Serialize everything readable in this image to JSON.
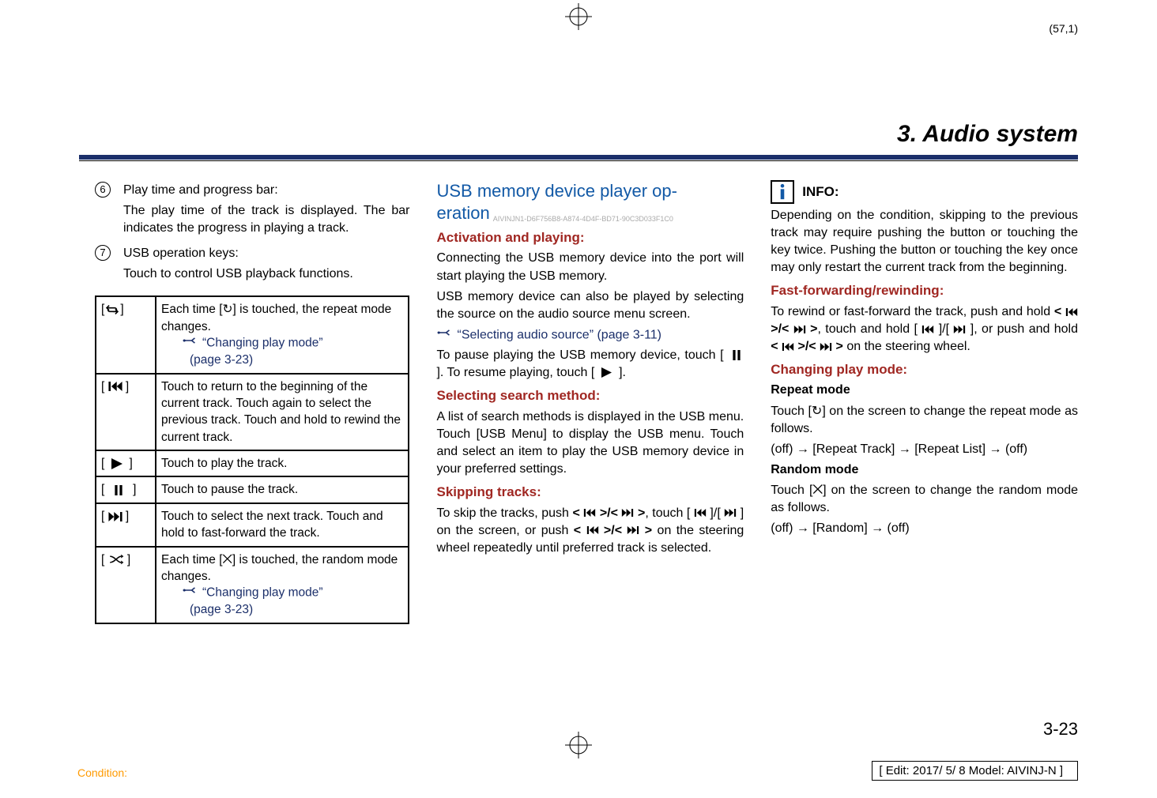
{
  "page_note_top": "(57,1)",
  "chapter_title": "3. Audio system",
  "col1": {
    "items": [
      {
        "num": "⑥",
        "title": "Play time and progress bar:",
        "desc": "The play time of the track is displayed. The bar indicates the progress in playing a track."
      },
      {
        "num": "⑦",
        "title": "USB operation keys:",
        "desc": "Touch to control USB playback functions."
      }
    ],
    "table": [
      {
        "icon": "repeat",
        "lines": [
          "Each time [↻] is touched, the repeat mode changes."
        ],
        "xref_label": "“Changing play mode”",
        "xref_page": "(page 3-23)"
      },
      {
        "icon": "prev",
        "lines": [
          "Touch to return to the beginning of the current track. Touch again to select the previous track. Touch and hold to rewind the current track."
        ]
      },
      {
        "icon": "play",
        "lines": [
          "Touch to play the track."
        ]
      },
      {
        "icon": "pause",
        "lines": [
          "Touch to pause the track."
        ]
      },
      {
        "icon": "next",
        "lines": [
          "Touch to select the next track. Touch and hold to fast-forward the track."
        ]
      },
      {
        "icon": "shuffle",
        "lines": [
          "Each time [⨉] is touched, the random mode changes."
        ],
        "xref_label": "“Changing play mode”",
        "xref_page": "(page 3-23)"
      }
    ]
  },
  "col2": {
    "sec_title1": "USB memory device player op-",
    "sec_title2": "eration",
    "sec_id": "AIVINJN1-D6F756B8-A874-4D4F-BD71-90C3D033F1C0",
    "h_activation": "Activation and playing:",
    "p1": "Connecting the USB memory device into the port will start playing the USB memory.",
    "p2": "USB memory device can also be played by selecting the source on the audio source menu screen.",
    "xref_source": "“Selecting audio source” (page 3-11)",
    "p3a": "To pause playing the USB memory device, touch [",
    "p3b": "]. To resume playing, touch [",
    "p3c": "].",
    "h_search": "Selecting search method:",
    "p4": "A list of search methods is displayed in the USB menu. Touch [USB Menu] to display the USB menu. Touch and select an item to play the USB memory device in your preferred settings.",
    "h_skip": "Skipping tracks:",
    "p5a": "To skip the tracks, push ",
    "p5b": ", touch [",
    "p5c": "]/[",
    "p5d": "] on the screen, or push ",
    "p5e": " on the steering wheel repeatedly until preferred track is selected."
  },
  "col3": {
    "info_label": "INFO:",
    "p1": "Depending on the condition, skipping to the previous track may require pushing the button or touching the key twice. Pushing the button or touching the key once may only restart the current track from the beginning.",
    "h_ff": "Fast-forwarding/rewinding:",
    "p2a": "To rewind or fast-forward the track, push and hold ",
    "p2b": ", touch and hold [",
    "p2c": "]/[",
    "p2d": "], or push and hold ",
    "p2e": " on the steering wheel.",
    "h_change": "Changing play mode:",
    "h_repeat": "Repeat mode",
    "p3": "Touch [↻] on the screen to change the repeat mode as follows.",
    "p4": "(off) → [Repeat Track] → [Repeat List] → (off)",
    "h_random": "Random mode",
    "p5": "Touch [⨉] on the screen to change the random mode as follows.",
    "p6": "(off) → [Random] → (off)"
  },
  "page_number": "3-23",
  "footer_condition": "Condition:",
  "footer_edit": "[ Edit: 2017/ 5/ 8   Model:  AIVINJ-N ]"
}
